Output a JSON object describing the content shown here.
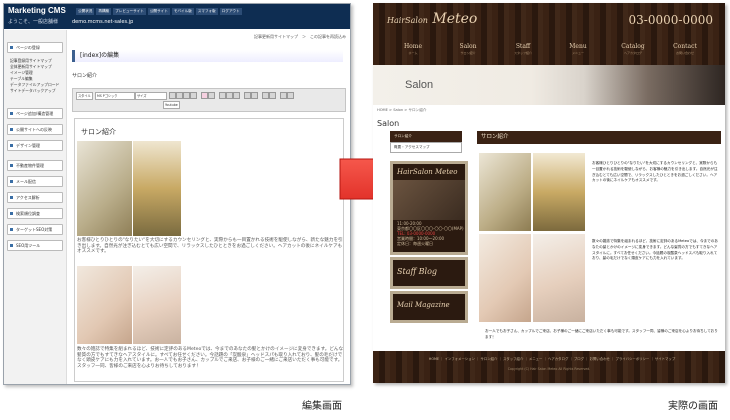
{
  "cms": {
    "logo": "Marketing CMS",
    "welcome": "ようこそ、一般店舗様",
    "domain": "demo.mcms.net-sales.jp",
    "topnav": [
      "公開状況",
      "再構築",
      "プレビューサイト",
      "公開サイト",
      "モバイル版",
      "スマフォ版",
      "ログアウト"
    ],
    "side": {
      "btn_page_list": "ページの登録",
      "sub_items": [
        "記事登録用サイトマップ",
        "全体更新用サイトマップ",
        "イメージ管理",
        "テーブル編集",
        "データファイルアップロード",
        "サイトデータバックアップ"
      ],
      "btn_page_structure": "ページ追加/構造管理",
      "btn_public": "公開サイトへの反映",
      "btn_design": "デザイン管理",
      "btn_property": "不動産物件管理",
      "btn_mail": "メール配信",
      "btn_access": "アクセス解析",
      "btn_ranking": "検索順位調査",
      "btn_seo": "ターゲットSEO対策",
      "btn_tool": "SEO用ツール"
    },
    "crumb": "記事更新用サイトマップ　＞　この記事を再読込み",
    "heading": "[index]の編集",
    "field_label": "サロン紹介",
    "toolbar": {
      "style": "スタイル",
      "font": "MS Pゴシック",
      "size": "サイズ",
      "youtube": "Youtube"
    },
    "editor": {
      "title": "サロン紹介",
      "text1": "お客様ひとりひとりの\"なりたい\"を大切にするカウンセリングと、実際からも一目置かれる技術を駆使しながら、新たな魅力を引き出します。自然光が注ぎ込むとても広い空間で、リラックスしたひとときをお過ごしください。ヘアカットの後にネイルケアもオススメです。",
      "text2": "数々の雑誌で特集を組まれるほど、技術に定評のあるMeteoでは、今までのあなたの髪とかけのイメージに変身できます。どんな髪質の方でもすてきなヘアスタイルに。すべてお任せください。今話題の「炭酸泉」ヘッドスパも取り入れており、髪の毛だけでなく頭皮ケアにも力を入れています。お一人でもお子さん、カップルでご来店、お子様のご一緒にご来店いただく事も可能です。スタッフ一同、皆様のご来店を心よりお待ちしております！"
    }
  },
  "site": {
    "logo_small": "HairSalon",
    "logo_big": "Meteo",
    "phone": "03-0000-0000",
    "nav": [
      {
        "label": "Home",
        "sub": "ホーム"
      },
      {
        "label": "Salon",
        "sub": "サロン紹介"
      },
      {
        "label": "Staff",
        "sub": "スタッフ紹介"
      },
      {
        "label": "Menu",
        "sub": "メニュー"
      },
      {
        "label": "Catalog",
        "sub": "ヘアカタログ"
      },
      {
        "label": "Contact",
        "sub": "お問い合わせ"
      }
    ],
    "banner_title": "Salon",
    "crumb": "HOME > Salon > サロン紹介",
    "page_title": "Salon",
    "side_links": [
      "サロン紹介",
      "概要・アクセスマップ"
    ],
    "side_block_title": "HairSalon Meteo",
    "side_info": [
      "TEL: 03-0000-0000",
      "11:00-20:00",
      "東京都〇〇区〇〇〇-〇〇-〇〇(MAP)",
      "定休日：毎週火曜日",
      "営業時間：10:00～20:00"
    ],
    "staff_blog": "Staff Blog",
    "mail_magazine": "Mail Magazine",
    "main_heading": "サロン紹介",
    "p1": "お客様ひとりひとりの\"なりたい\"を大切にするカウンセリングと、実際からも一目置かれる技術を駆使しながら、お客様の魅力を引き出します。自然光が注ぎ込むとても広い空間で、リラックスしたひとときをお過ごしください。ヘアカットの後にネイルケアもオススメです。",
    "p2": "数々の雑誌で特集を組まれるほど、技術に定評のあるMeteoでは、今までのあなたの髪とかけのイメージに変身できます。どんな髪質の方でもすてきなヘアスタイルに。すべてお任せください。今話題の炭酸泉ヘッドスパも取り入れており、髪の毛だけでなく頭皮ケアにも力を入れています。",
    "p3": "お一人でもお子さん、カップルでご来店、お子様のご一緒にご来店いただく事も可能です。スタッフ一同、皆様のご来店を心よりお待ちしております！",
    "footer_links": "HOME ｜ インフォメーション ｜ サロン紹介 ｜ スタッフ紹介 ｜ メニュー ｜ ヘアカタログ ｜ ブログ ｜ お問い合わせ ｜ プライバシーポリシー ｜ サイトマップ",
    "copyright": "Copyright (C) Hair Salon Meteo All Rights Reserved."
  },
  "captions": {
    "left": "編集画面",
    "right": "実際の画面"
  }
}
